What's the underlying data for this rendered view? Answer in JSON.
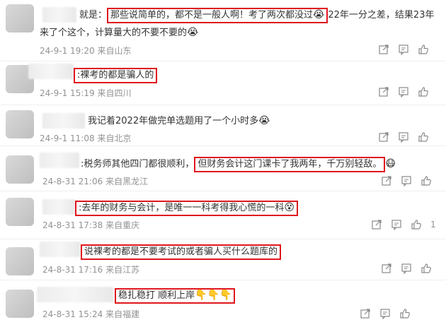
{
  "comments": [
    {
      "prefix": "就是：",
      "highlight": "那些说简单的，都不是一般人啊！考了两次都没过",
      "emoji": "😭",
      "rest_line1": "22年一分之差，结果23年",
      "line2": "来了个这个，计算量大的不要不要的",
      "line2_emoji": "😭",
      "date": "24-9-1 19:20",
      "location": "来自山东",
      "likes": ""
    },
    {
      "highlight": ":裸考的都是骗人的",
      "date": "24-9-1 15:19",
      "location": "来自四川",
      "likes": ""
    },
    {
      "text": "我记着2022年做完单选题用了一个小时多",
      "emoji": "😭",
      "date": "24-9-1 11:08",
      "location": "来自北京",
      "likes": ""
    },
    {
      "prefix": ":税务师其他四门都很顺利，",
      "highlight": "但财务会计这门课卡了我两年，千万别轻敌。",
      "emoji": "😷",
      "date": "24-8-31 21:06",
      "location": "来自黑龙江",
      "likes": ""
    },
    {
      "highlight": ":去年的财务与会计，是唯一一科考得我心慌的一科",
      "emoji": "😵",
      "date": "24-8-31 17:38",
      "location": "来自重庆",
      "likes": "1"
    },
    {
      "highlight": "说裸考的都是不要考试的或者骗人买什么题库的",
      "date": "24-8-31 17:16",
      "location": "来自江苏",
      "likes": ""
    },
    {
      "highlight": "稳扎稳打 顺利上岸",
      "emoji": "👇👇👇",
      "date": "24-8-31 15:24",
      "location": "来自福建",
      "likes": ""
    }
  ],
  "icons": [
    "share-icon",
    "comment-icon",
    "like-icon"
  ],
  "colors": {
    "highlight_border": "#e0161d",
    "meta": "#939393",
    "text": "#333333"
  }
}
